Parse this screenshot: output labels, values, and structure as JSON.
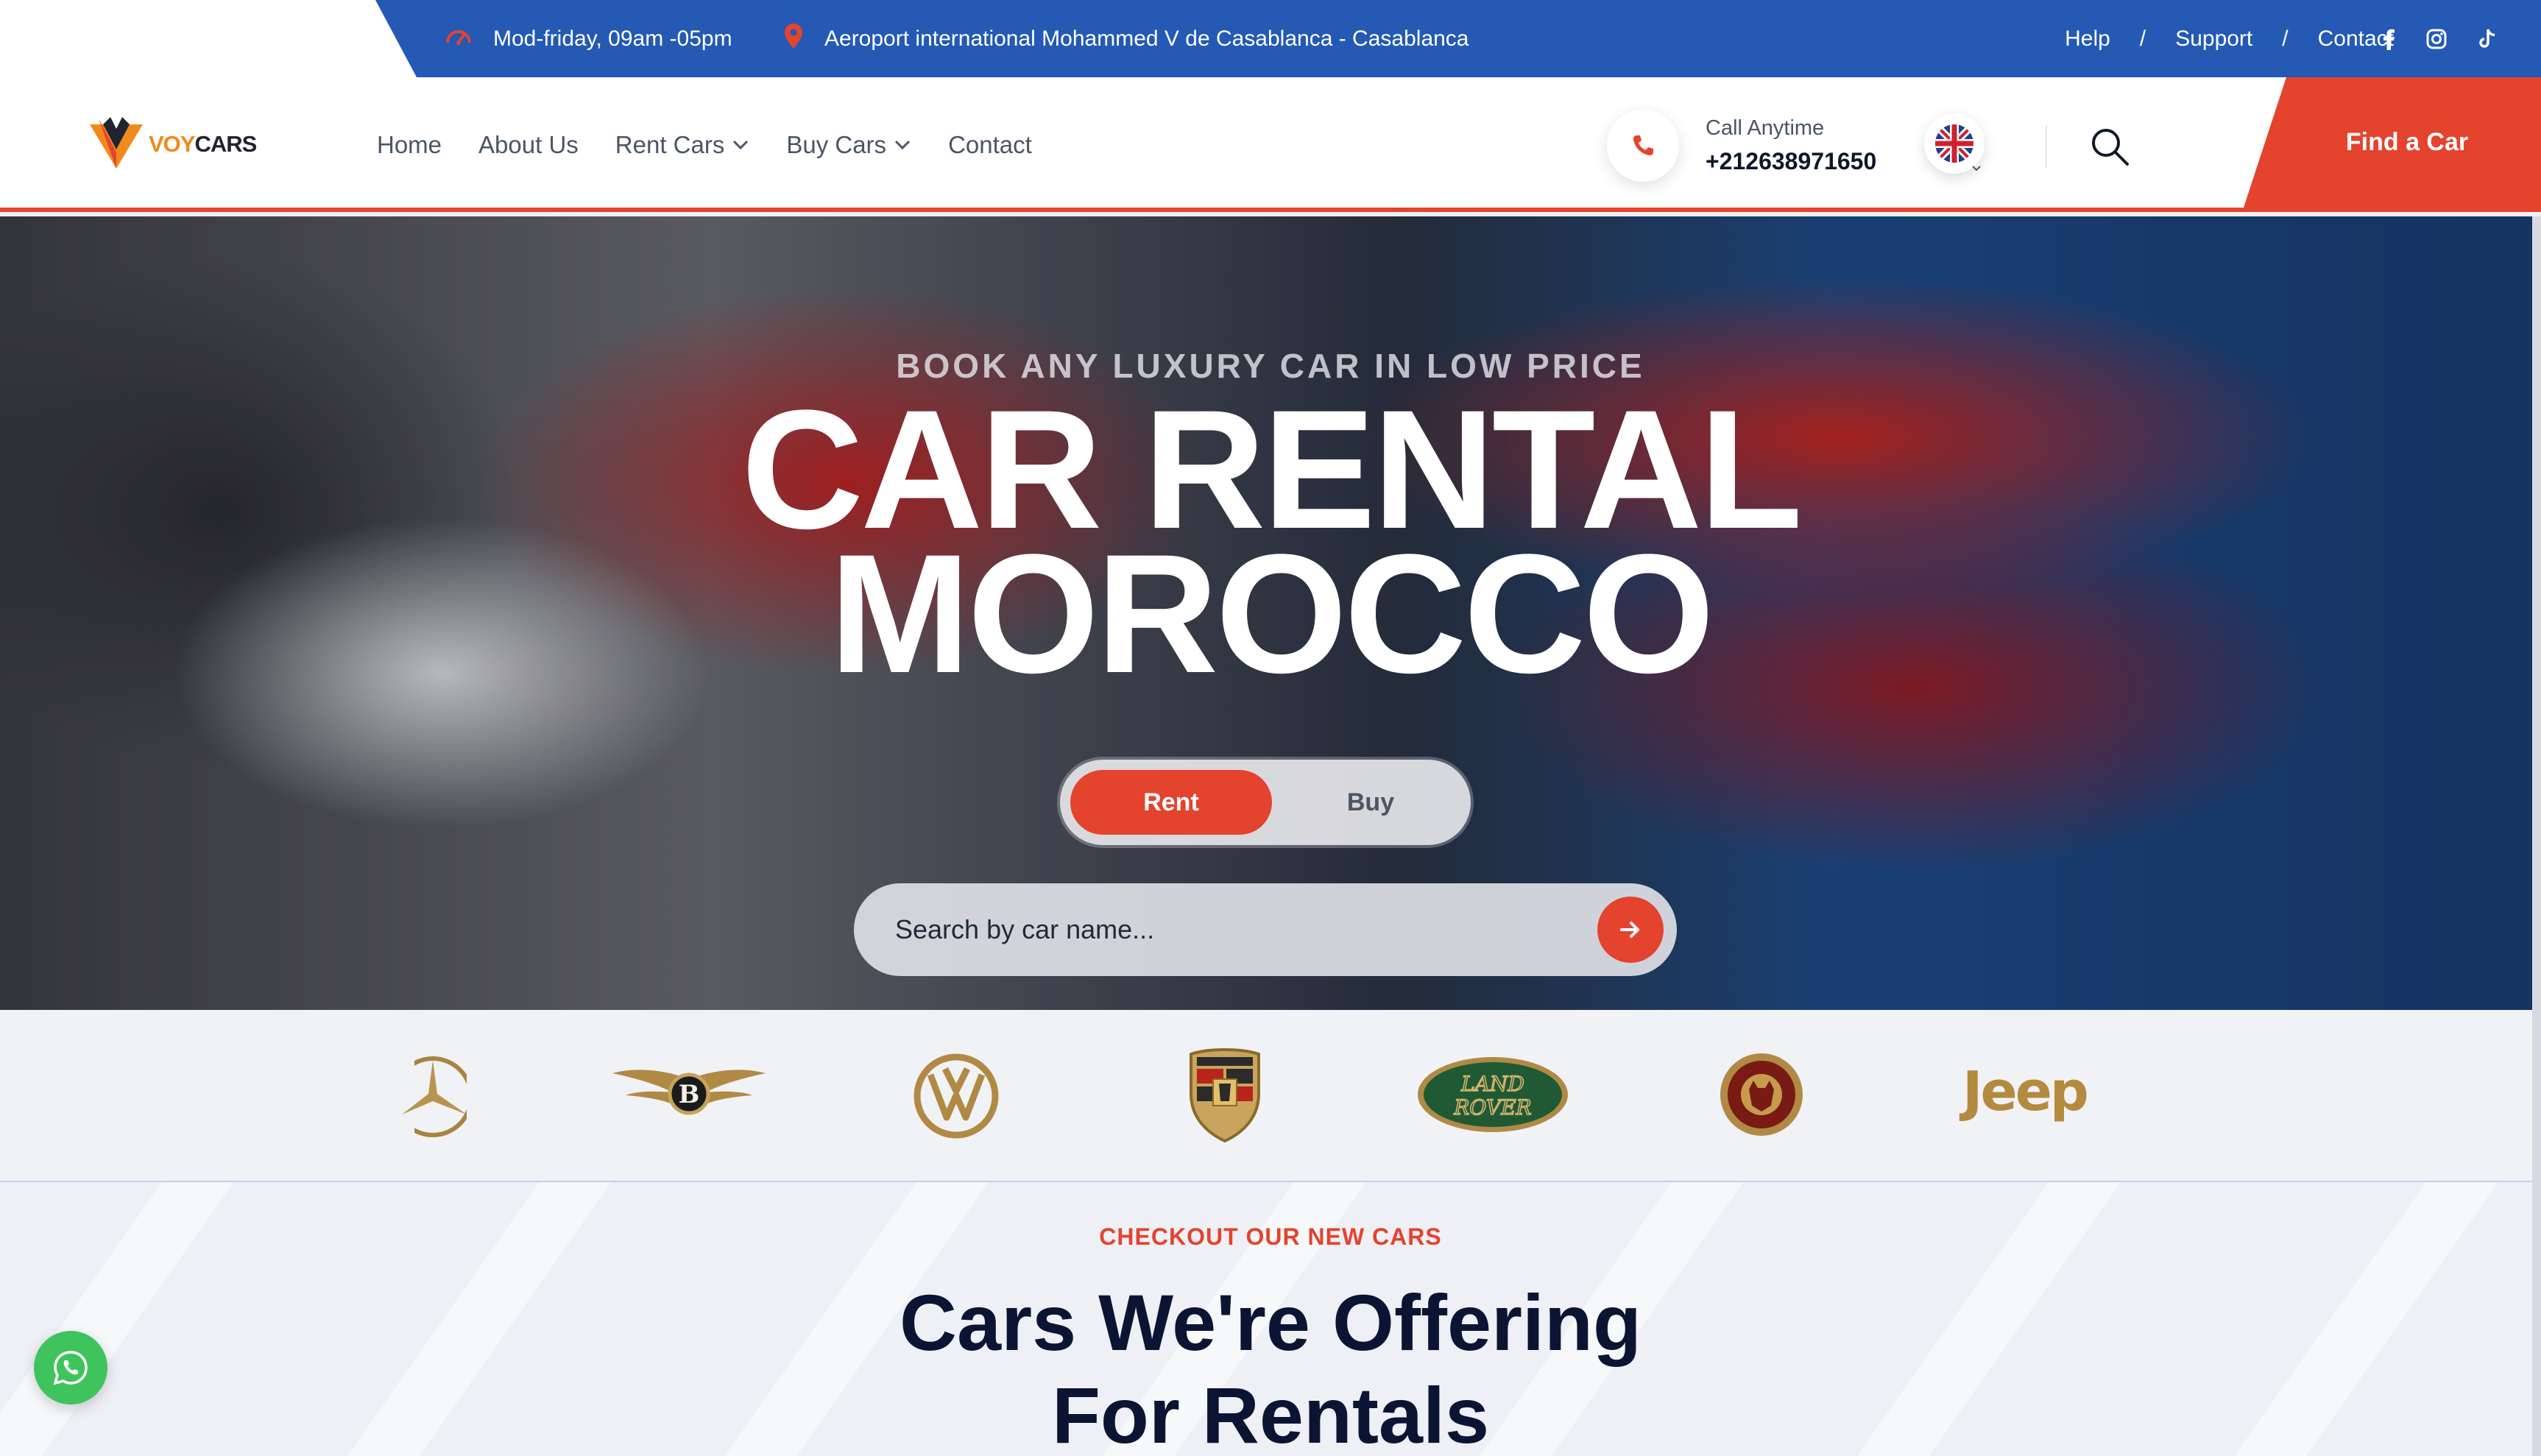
{
  "topbar": {
    "hours": "Mod-friday, 09am -05pm",
    "address": "Aeroport international Mohammed V de Casablanca - Casablanca",
    "links": [
      "Help",
      "Support",
      "Contact"
    ],
    "separator": "/",
    "social_icons": [
      "facebook-icon",
      "instagram-icon",
      "tiktok-icon"
    ]
  },
  "header": {
    "logo": {
      "part1": "VOY",
      "part2": "CARS"
    },
    "nav": [
      "Home",
      "About Us",
      "Rent Cars",
      "Buy Cars",
      "Contact"
    ],
    "call_label": "Call Anytime",
    "call_number": "+212638971650",
    "language_icon": "uk-flag-icon",
    "cta": "Find a Car"
  },
  "hero": {
    "subtitle": "BOOK ANY LUXURY CAR IN LOW PRICE",
    "title_line1": "CAR RENTAL",
    "title_line2": "MOROCCO",
    "toggle_rent": "Rent",
    "toggle_buy": "Buy",
    "search_placeholder": "Search by car name..."
  },
  "brands": {
    "items": [
      "mercedes-logo",
      "bentley-logo",
      "volkswagen-logo",
      "porsche-logo",
      "land-rover-logo",
      "jaguar-logo",
      "jeep-logo"
    ],
    "land_rover_text_1": "LAND",
    "land_rover_text_2": "ROVER",
    "bentley_letter": "B",
    "jeep_text": "Jeep"
  },
  "offering": {
    "eyebrow": "CHECKOUT OUR NEW CARS",
    "title_line1": "Cars We're Offering",
    "title_line2": "For Rentals"
  },
  "colors": {
    "accent": "#e4432d",
    "topbar_blue": "#2459b4",
    "heading": "#0b1533",
    "whatsapp": "#3fc35c"
  }
}
